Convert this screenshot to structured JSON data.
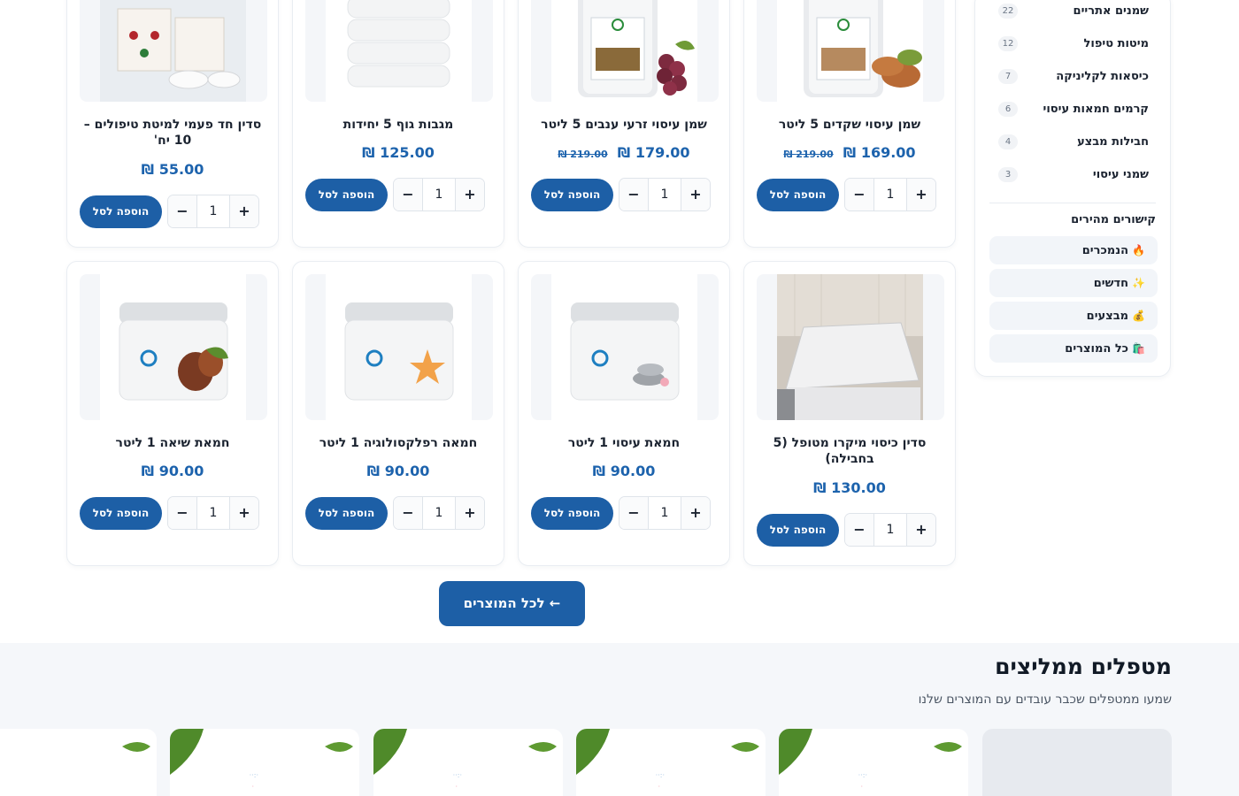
{
  "sidebar": {
    "categories": [
      {
        "label": "שמנים אתריים",
        "count": "22"
      },
      {
        "label": "מיטות טיפול",
        "count": "12"
      },
      {
        "label": "כיסאות לקליניקה",
        "count": "7"
      },
      {
        "label": "קרמים חמאות עיסוי",
        "count": "6"
      },
      {
        "label": "חבילות מבצע",
        "count": "4"
      },
      {
        "label": "שמני עיסוי",
        "count": "3"
      }
    ],
    "quick_links_title": "קישורים מהירים",
    "quick_links": [
      {
        "emoji": "🔥",
        "label": "הנמכרים"
      },
      {
        "emoji": "✨",
        "label": "חדשים"
      },
      {
        "emoji": "💰",
        "label": "מבצעים"
      },
      {
        "emoji": "🛍️",
        "label": "כל המוצרים"
      }
    ]
  },
  "products": [
    {
      "name": "שמן עיסוי שקדים 5 ליטר",
      "price": "169.00 ₪",
      "old_price": "219.00 ₪",
      "qty": "1",
      "add_label": "הוספה לסל",
      "image": "almond-oil-jug-image"
    },
    {
      "name": "שמן עיסוי זרעי ענבים 5 ליטר",
      "price": "179.00 ₪",
      "old_price": "219.00 ₪",
      "qty": "1",
      "add_label": "הוספה לסל",
      "image": "grape-seed-oil-jug-image"
    },
    {
      "name": "מגבות גוף 5 יחידות",
      "price": "125.00 ₪",
      "old_price": "",
      "qty": "1",
      "add_label": "הוספה לסל",
      "image": "towels-stack-image"
    },
    {
      "name": "סדין חד פעמי למיטת טיפולים – 10 יח'",
      "price": "55.00 ₪",
      "old_price": "",
      "qty": "1",
      "add_label": "הוספה לסל",
      "image": "disposable-sheets-image"
    },
    {
      "name": "סדין כיסוי מיקרו מטופל (5 בחבילה)",
      "price": "130.00 ₪",
      "old_price": "",
      "qty": "1",
      "add_label": "הוספה לסל",
      "image": "treatment-bed-cover-image"
    },
    {
      "name": "חמאת עיסוי 1 ליטר",
      "price": "90.00 ₪",
      "old_price": "",
      "qty": "1",
      "add_label": "הוספה לסל",
      "image": "massage-butter-jar-image"
    },
    {
      "name": "חמאה רפלקסולוגיה 1 ליטר",
      "price": "90.00 ₪",
      "old_price": "",
      "qty": "1",
      "add_label": "הוספה לסל",
      "image": "reflexology-butter-jar-image"
    },
    {
      "name": "חמאת שיאה 1 ליטר",
      "price": "90.00 ₪",
      "old_price": "",
      "qty": "1",
      "add_label": "הוספה לסל",
      "image": "shea-butter-jar-image"
    }
  ],
  "all_products_button": "← לכל המוצרים",
  "testimonials": {
    "title": "מטפלים ממליצים",
    "subtitle": "שמעו ממטפלים שכבר עובדים עם המוצרים שלנו"
  },
  "colors": {
    "primary": "#1d5fa6",
    "price": "#1d63ad",
    "card_border": "#e9edf2",
    "section_bg": "#f5f7fa"
  }
}
